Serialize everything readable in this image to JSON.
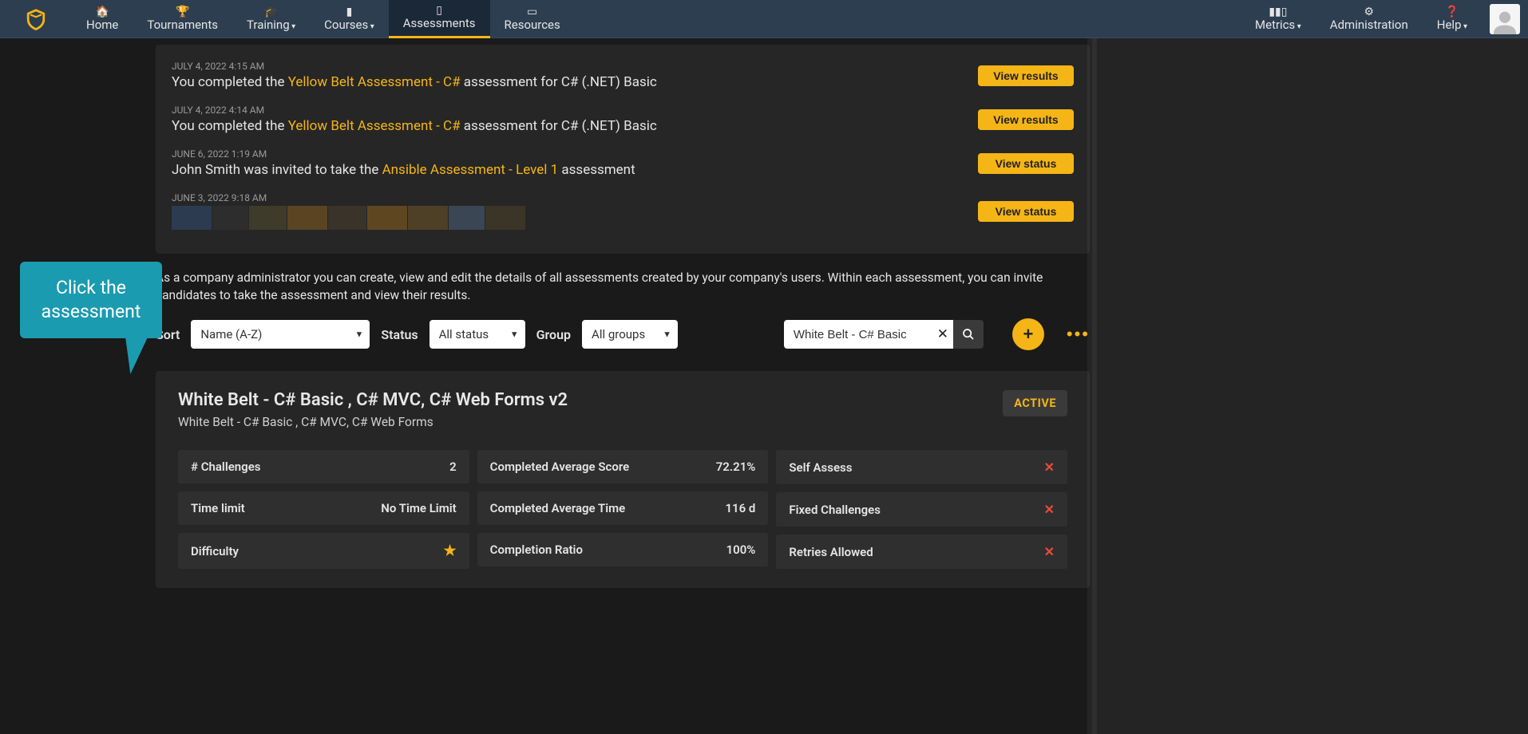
{
  "nav": {
    "home": "Home",
    "tournaments": "Tournaments",
    "training": "Training",
    "courses": "Courses",
    "assessments": "Assessments",
    "resources": "Resources",
    "metrics": "Metrics",
    "administration": "Administration",
    "help": "Help"
  },
  "callout": {
    "line1": "Click the",
    "line2": "assessment"
  },
  "activity": [
    {
      "date": "JULY 4, 2022 4:15 AM",
      "prefix": "You completed the ",
      "link": "Yellow Belt Assessment - C#",
      "suffix": " assessment for C# (.NET) Basic",
      "button": "View results"
    },
    {
      "date": "JULY 4, 2022 4:14 AM",
      "prefix": "You completed the ",
      "link": "Yellow Belt Assessment - C#",
      "suffix": " assessment for C# (.NET) Basic",
      "button": "View results"
    },
    {
      "date": "JUNE 6, 2022 1:19 AM",
      "prefix": "John Smith was invited to take the ",
      "link": "Ansible Assessment - Level 1",
      "suffix": " assessment",
      "button": "View status"
    },
    {
      "date": "JUNE 3, 2022 9:18 AM",
      "prefix": "",
      "link": "",
      "suffix": "",
      "button": "View status"
    }
  ],
  "intro": "As a company administrator you can create, view and edit the details of all assessments created by your company's users. Within each assessment, you can invite candidates to take the assessment and view their results.",
  "filters": {
    "sort_label": "Sort",
    "sort_value": "Name (A-Z)",
    "status_label": "Status",
    "status_value": "All status",
    "group_label": "Group",
    "group_value": "All groups",
    "search_value": "White Belt - C# Basic"
  },
  "assessment": {
    "title": "White Belt - C# Basic , C# MVC, C# Web Forms v2",
    "subtitle": "White Belt - C# Basic , C# MVC, C# Web Forms",
    "status": "ACTIVE",
    "stats": {
      "challenges_label": "#   Challenges",
      "challenges_value": "2",
      "time_limit_label": "Time limit",
      "time_limit_value": "No Time Limit",
      "difficulty_label": "Difficulty",
      "difficulty_value": "★",
      "avg_score_label": "Completed Average Score",
      "avg_score_value": "72.21%",
      "avg_time_label": "Completed Average Time",
      "avg_time_value": "116 d",
      "completion_ratio_label": "Completion Ratio",
      "completion_ratio_value": "100%",
      "self_assess_label": "Self Assess",
      "fixed_challenges_label": "Fixed Challenges",
      "retries_allowed_label": "Retries Allowed"
    }
  }
}
